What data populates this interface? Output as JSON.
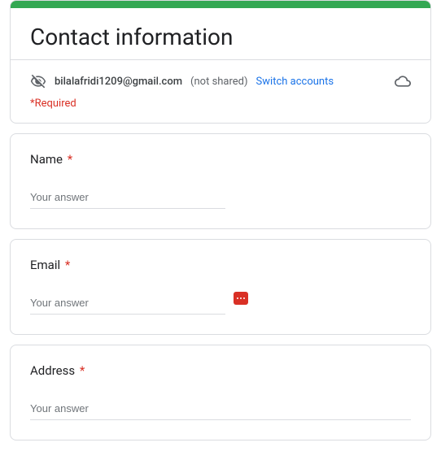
{
  "header": {
    "title": "Contact information",
    "email": "bilalafridi1209@gmail.com",
    "not_shared": "(not shared)",
    "switch_label": "Switch accounts",
    "required_note": "*Required"
  },
  "questions": {
    "name": {
      "label": "Name",
      "required_mark": "*",
      "placeholder": "Your answer"
    },
    "email": {
      "label": "Email",
      "required_mark": "*",
      "placeholder": "Your answer"
    },
    "address": {
      "label": "Address",
      "required_mark": "*",
      "placeholder": "Your answer"
    }
  }
}
